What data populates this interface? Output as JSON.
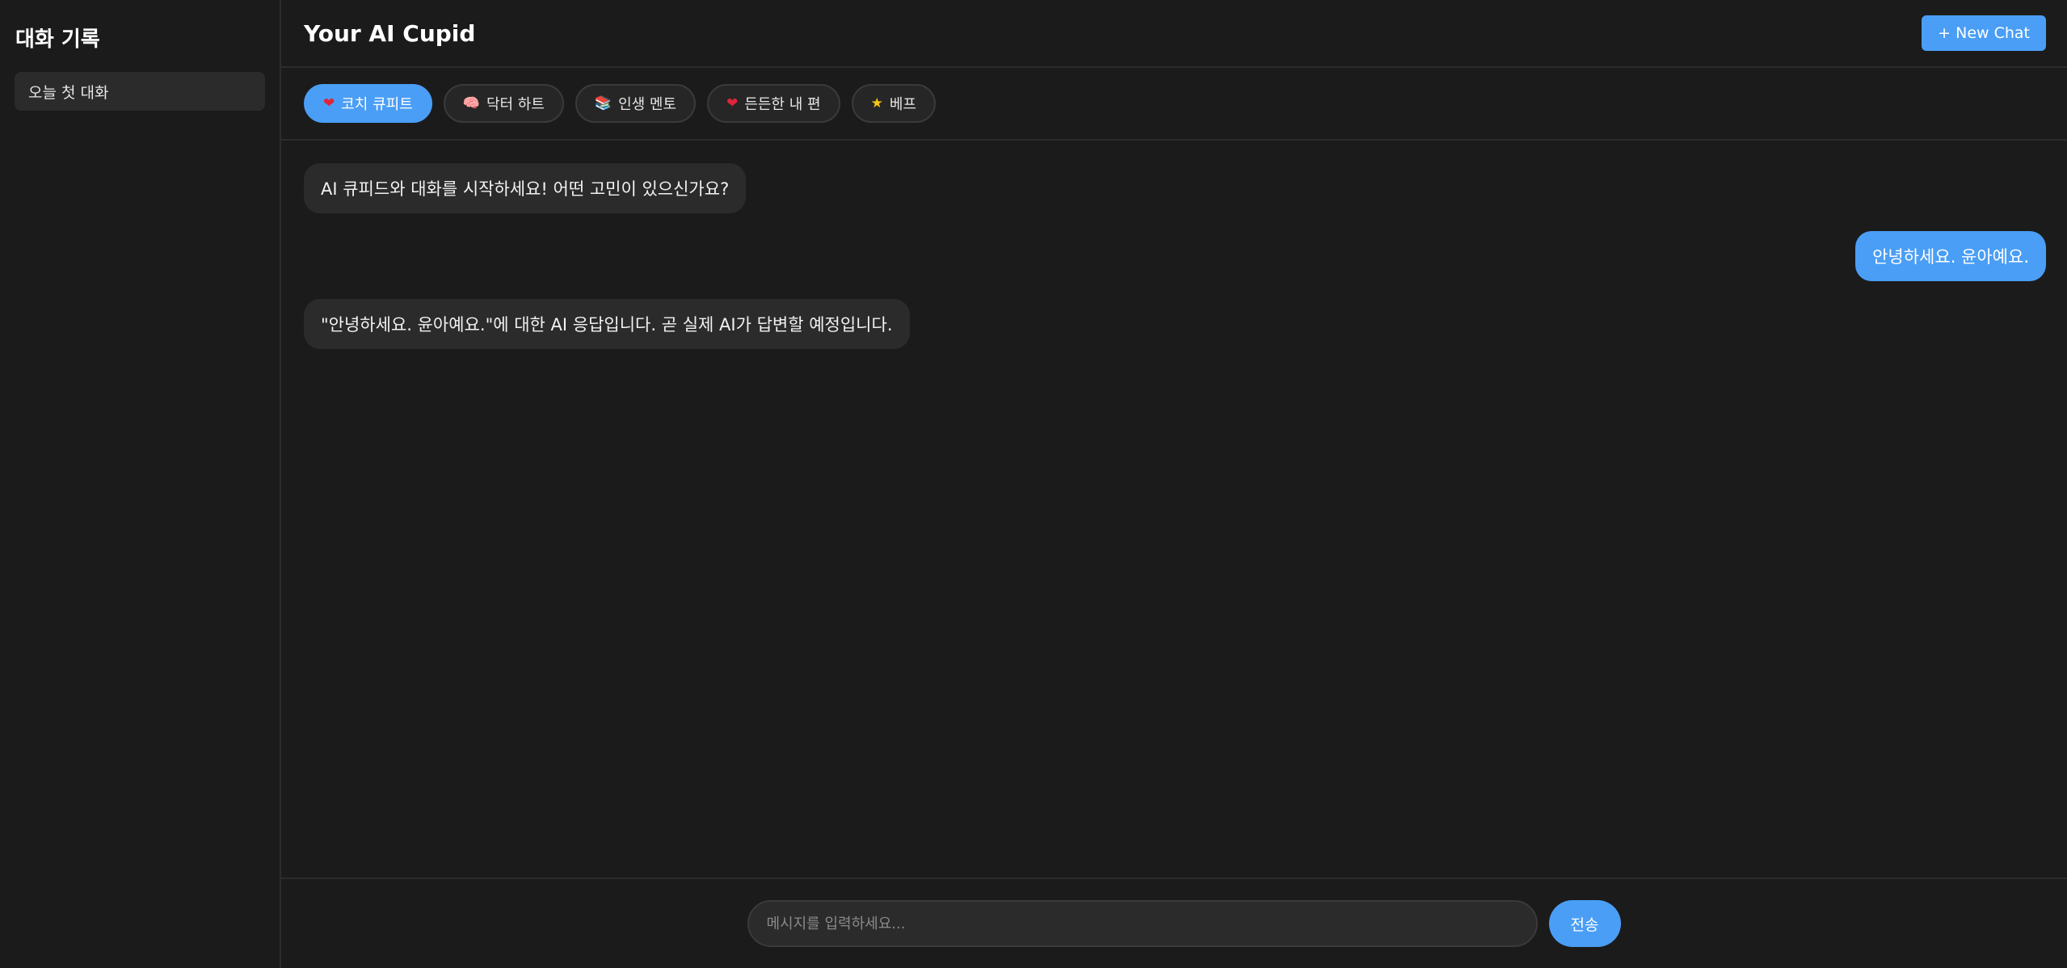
{
  "colors": {
    "background": "#1b1b1b",
    "surface": "#2b2b2b",
    "accent": "#4a9ef5",
    "border": "#2c2c2c"
  },
  "sidebar": {
    "title": "대화 기록",
    "items": [
      {
        "label": "오늘 첫 대화"
      }
    ]
  },
  "header": {
    "title": "Your AI Cupid",
    "new_chat_label": "+ New Chat"
  },
  "personas": [
    {
      "icon": "❤",
      "icon_name": "heart-icon",
      "label": "코치 큐피트",
      "active": true
    },
    {
      "icon": "🧠",
      "icon_name": "brain-icon",
      "label": "닥터 하트",
      "active": false
    },
    {
      "icon": "📚",
      "icon_name": "books-icon",
      "label": "인생 멘토",
      "active": false
    },
    {
      "icon": "❤",
      "icon_name": "heart-icon",
      "label": "든든한 내 편",
      "active": false
    },
    {
      "icon": "★",
      "icon_name": "star-icon",
      "label": "베프",
      "active": false
    }
  ],
  "messages": [
    {
      "role": "ai",
      "text": "AI 큐피드와 대화를 시작하세요! 어떤 고민이 있으신가요?"
    },
    {
      "role": "user",
      "text": "안녕하세요. 윤아예요."
    },
    {
      "role": "ai",
      "text": "\"안녕하세요. 윤아예요.\"에 대한 AI 응답입니다. 곧 실제 AI가 답변할 예정입니다."
    }
  ],
  "composer": {
    "placeholder": "메시지를 입력하세요...",
    "value": "",
    "send_label": "전송"
  }
}
